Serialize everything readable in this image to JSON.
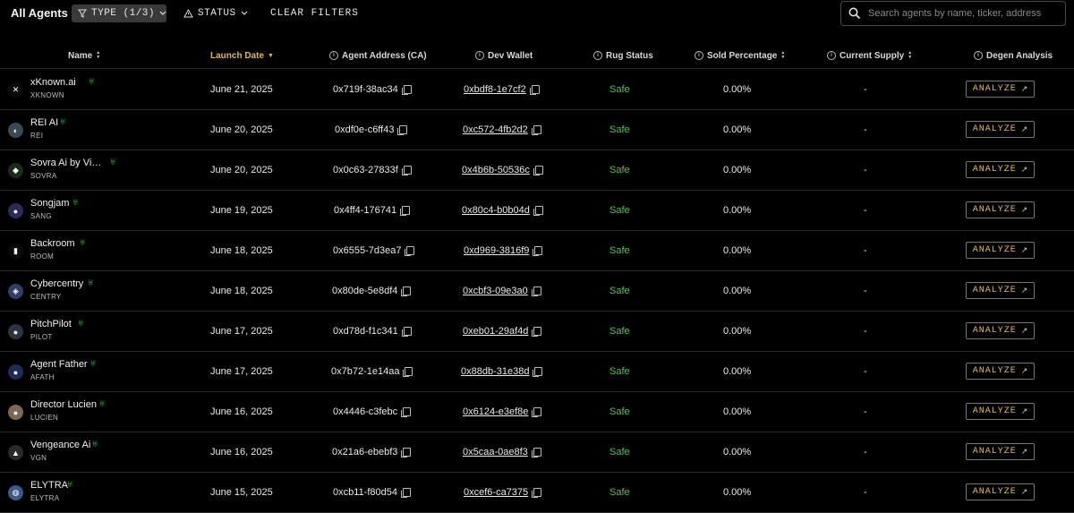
{
  "topbar": {
    "title": "All Agents",
    "type_filter": "TYPE (1/3)",
    "status_filter": "STATUS",
    "clear_filters": "CLEAR FILTERS",
    "search_placeholder": "Search agents by name, ticker, address"
  },
  "columns": {
    "name": "Name",
    "launch_date": "Launch Date",
    "agent_address": "Agent Address (CA)",
    "dev_wallet": "Dev Wallet",
    "rug_status": "Rug Status",
    "sold_percentage": "Sold Percentage",
    "current_supply": "Current Supply",
    "degen_analysis": "Degen Analysis"
  },
  "analyze_label": "ANALYZE",
  "colors": {
    "accent": "#e0b66a",
    "safe": "#56c256",
    "background": "#000000"
  },
  "rows": [
    {
      "name": "xKnown.ai",
      "ticker": "XKNOWN",
      "date": "June 21, 2025",
      "ca": "0x719f-38ac34",
      "dev": "0xbdf8-1e7cf2",
      "rug": "Safe",
      "sold": "0.00%",
      "supply": "-",
      "avatar": "✕",
      "avatar_bg": "#0b0b0b"
    },
    {
      "name": "REI AI",
      "ticker": "REI",
      "date": "June 20, 2025",
      "ca": "0xdf0e-c6ff43",
      "dev": "0xc572-4fb2d2",
      "rug": "Safe",
      "sold": "0.00%",
      "supply": "-",
      "avatar": "◐",
      "avatar_bg": "#3a4a55"
    },
    {
      "name": "Sovra Ai by Vir...",
      "ticker": "SOVRA",
      "date": "June 20, 2025",
      "ca": "0x0c63-27833f",
      "dev": "0x4b6b-50536c",
      "rug": "Safe",
      "sold": "0.00%",
      "supply": "-",
      "avatar": "◆",
      "avatar_bg": "#1d2a1a"
    },
    {
      "name": "Songjam",
      "ticker": "SANG",
      "date": "June 19, 2025",
      "ca": "0x4ff4-176741",
      "dev": "0x80c4-b0b04d",
      "rug": "Safe",
      "sold": "0.00%",
      "supply": "-",
      "avatar": "●",
      "avatar_bg": "#2c2a5a"
    },
    {
      "name": "Backroom",
      "ticker": "ROOM",
      "date": "June 18, 2025",
      "ca": "0x6555-7d3ea7",
      "dev": "0xd969-3816f9",
      "rug": "Safe",
      "sold": "0.00%",
      "supply": "-",
      "avatar": "▮",
      "avatar_bg": "#0b0b0b"
    },
    {
      "name": "Cybercentry",
      "ticker": "CENTRY",
      "date": "June 18, 2025",
      "ca": "0x80de-5e8df4",
      "dev": "0xcbf3-09e3a0",
      "rug": "Safe",
      "sold": "0.00%",
      "supply": "-",
      "avatar": "◈",
      "avatar_bg": "#2e3e6a"
    },
    {
      "name": "PitchPilot",
      "ticker": "PILOT",
      "date": "June 17, 2025",
      "ca": "0xd78d-f1c341",
      "dev": "0xeb01-29af4d",
      "rug": "Safe",
      "sold": "0.00%",
      "supply": "-",
      "avatar": "●",
      "avatar_bg": "#2a3440"
    },
    {
      "name": "Agent Father",
      "ticker": "AFATH",
      "date": "June 17, 2025",
      "ca": "0x7b72-1e14aa",
      "dev": "0x88db-31e38d",
      "rug": "Safe",
      "sold": "0.00%",
      "supply": "-",
      "avatar": "●",
      "avatar_bg": "#1d2d5a"
    },
    {
      "name": "Director Lucien",
      "ticker": "LUCIEN",
      "date": "June 16, 2025",
      "ca": "0x4446-c3febc",
      "dev": "0x6124-e3ef8e",
      "rug": "Safe",
      "sold": "0.00%",
      "supply": "-",
      "avatar": "●",
      "avatar_bg": "#7a6a55"
    },
    {
      "name": "Vengeance Ai",
      "ticker": "VGN",
      "date": "June 16, 2025",
      "ca": "0x21a6-ebebf3",
      "dev": "0x5caa-0ae8f3",
      "rug": "Safe",
      "sold": "0.00%",
      "supply": "-",
      "avatar": "▲",
      "avatar_bg": "#2a2a2a"
    },
    {
      "name": "ELYTRA",
      "ticker": "ELYTRA",
      "date": "June 15, 2025",
      "ca": "0xcb11-f80d54",
      "dev": "0xcef6-ca7375",
      "rug": "Safe",
      "sold": "0.00%",
      "supply": "-",
      "avatar": "◍",
      "avatar_bg": "#3b5a8a"
    }
  ]
}
